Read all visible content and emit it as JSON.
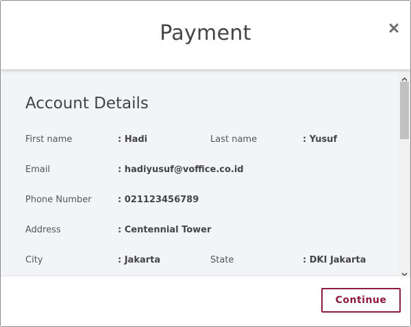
{
  "header": {
    "title": "Payment",
    "close_icon": "close-icon"
  },
  "body": {
    "section_title": "Account Details",
    "fields": {
      "first_name": {
        "label": "First name",
        "value": ": Hadi"
      },
      "last_name": {
        "label": "Last name",
        "value": ": Yusuf"
      },
      "email": {
        "label": "Email",
        "value": ": hadiyusuf@voffice.co.id"
      },
      "phone": {
        "label": "Phone Number",
        "value": ": 021123456789"
      },
      "address": {
        "label": "Address",
        "value": ": Centennial Tower"
      },
      "city": {
        "label": "City",
        "value": ": Jakarta"
      },
      "state": {
        "label": "State",
        "value": ": DKI Jakarta"
      }
    }
  },
  "footer": {
    "continue_label": "Continue"
  },
  "colors": {
    "accent": "#8b1a3c",
    "body_bg": "#f3f4f8",
    "text": "#444444"
  }
}
